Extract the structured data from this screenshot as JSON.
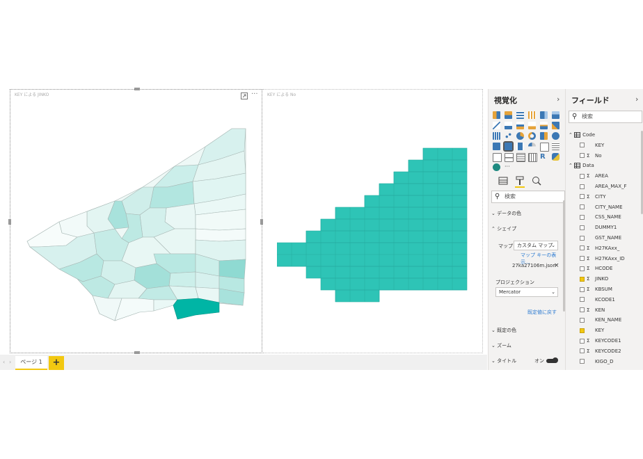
{
  "canvas": {
    "visual1_title": "KEY による JINKO",
    "visual2_title": "KEY による No",
    "focus_icon": "focus-mode-icon",
    "more_icon": "more-options-icon",
    "more_glyph": "···"
  },
  "page_tabs": {
    "tab_label": "ページ 1",
    "add_label": "+"
  },
  "viz_panel": {
    "title": "視覚化",
    "collapse_glyph": "›",
    "more_visuals": "···",
    "search_placeholder": "検索",
    "sections": {
      "data_colors": "データの色",
      "shape": "シェイプ",
      "default_colors": "既定の色",
      "zoom": "ズーム",
      "title": "タイトル"
    },
    "map_label": "マップ",
    "map_value": "カスタム マップ",
    "map_keys_link": "マップ キーの表示...",
    "map_file": "27ka27106m.json",
    "projection_label": "プロジェクション",
    "projection_value": "Mercator",
    "reset_link": "既定値に戻す",
    "title_toggle": "オン",
    "colors": {
      "accent": "#f2c811",
      "teal_dark": "#00b5a5",
      "teal_mid": "#2ec4b6"
    }
  },
  "fields_panel": {
    "title": "フィールド",
    "collapse_glyph": "›",
    "search_placeholder": "検索",
    "tables": [
      {
        "name": "Code",
        "fields": [
          {
            "name": "KEY",
            "sigma": false,
            "checked": false
          },
          {
            "name": "No",
            "sigma": true,
            "checked": false
          }
        ]
      },
      {
        "name": "Data",
        "fields": [
          {
            "name": "AREA",
            "sigma": true,
            "checked": false
          },
          {
            "name": "AREA_MAX_F",
            "sigma": false,
            "checked": false
          },
          {
            "name": "CITY",
            "sigma": true,
            "checked": false
          },
          {
            "name": "CITY_NAME",
            "sigma": false,
            "checked": false
          },
          {
            "name": "CSS_NAME",
            "sigma": false,
            "checked": false
          },
          {
            "name": "DUMMY1",
            "sigma": false,
            "checked": false
          },
          {
            "name": "GST_NAME",
            "sigma": false,
            "checked": false
          },
          {
            "name": "H27KAxx_",
            "sigma": true,
            "checked": false
          },
          {
            "name": "H27KAxx_ID",
            "sigma": true,
            "checked": false
          },
          {
            "name": "HCODE",
            "sigma": true,
            "checked": false
          },
          {
            "name": "JINKO",
            "sigma": true,
            "checked": true
          },
          {
            "name": "KBSUM",
            "sigma": true,
            "checked": false
          },
          {
            "name": "KCODE1",
            "sigma": false,
            "checked": false
          },
          {
            "name": "KEN",
            "sigma": true,
            "checked": false
          },
          {
            "name": "KEN_NAME",
            "sigma": false,
            "checked": false
          },
          {
            "name": "KEY",
            "sigma": false,
            "checked": true
          },
          {
            "name": "KEYCODE1",
            "sigma": true,
            "checked": false
          },
          {
            "name": "KEYCODE2",
            "sigma": true,
            "checked": false
          },
          {
            "name": "KIGO_D",
            "sigma": false,
            "checked": false
          }
        ]
      }
    ]
  }
}
